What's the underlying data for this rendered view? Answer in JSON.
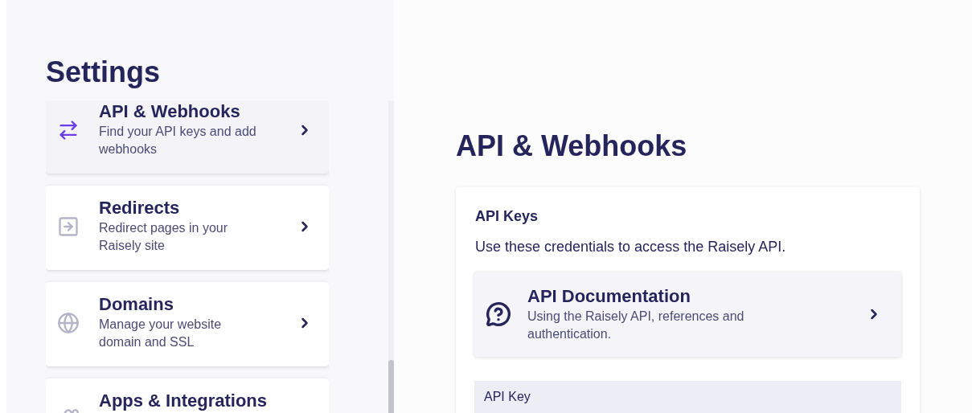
{
  "sidebar": {
    "title": "Settings",
    "items": [
      {
        "kind": "arrows",
        "title": "API & Webhooks",
        "description": "Find your API keys and add webhooks",
        "selected": true
      },
      {
        "kind": "redirect",
        "title": "Redirects",
        "description": "Redirect pages in your Raisely site",
        "selected": false
      },
      {
        "kind": "globe",
        "title": "Domains",
        "description": "Manage your website domain and SSL",
        "selected": false
      },
      {
        "kind": "apps",
        "title": "Apps & Integrations",
        "selected": false
      }
    ]
  },
  "main": {
    "heading": "API & Webhooks",
    "card": {
      "title": "API Keys",
      "text": "Use these credentials to access the Raisely API.",
      "link": {
        "title": "API Documentation",
        "description": "Using the Raisely API, references and authentication."
      },
      "field_label": "API Key"
    }
  }
}
